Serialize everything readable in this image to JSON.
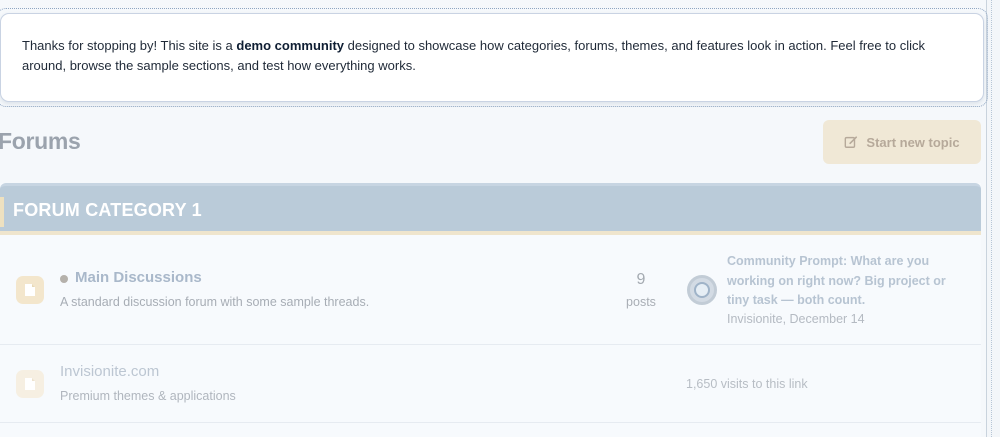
{
  "notice": {
    "text_before": "Thanks for stopping by! This site is a ",
    "bold": "demo community",
    "text_after": " designed to showcase how categories, forums, themes, and features look in action. Feel free to click around, browse the sample sections, and test how everything works."
  },
  "page_title": "Forums",
  "start_topic_label": "Start new topic",
  "category": {
    "title": "FORUM CATEGORY 1",
    "forums": [
      {
        "name": "Main Discussions",
        "description": "A standard discussion forum with some sample threads.",
        "post_count": "9",
        "post_label": "posts",
        "last_post_title": "Community Prompt: What are you working on right now? Big project or tiny task — both count.",
        "last_post_meta": "Invisionite, December 14",
        "icon": "document-icon"
      },
      {
        "name": "Invisionite.com",
        "description": "Premium themes & applications",
        "visits": "1,650 visits to this link",
        "icon": "document-icon"
      }
    ]
  },
  "colors": {
    "category_header": "#bacbd9",
    "button_bg": "#f0e8d6",
    "accent_gold": "#efe5cd"
  }
}
